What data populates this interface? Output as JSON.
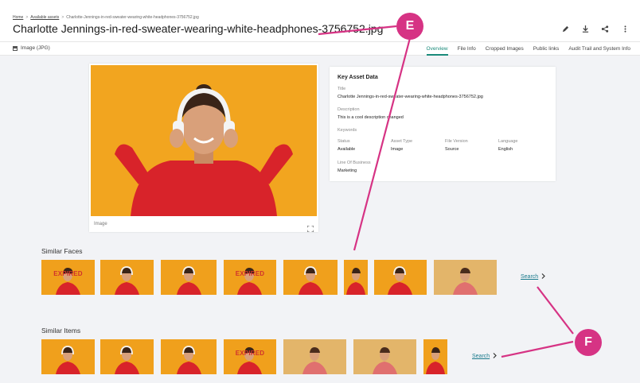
{
  "breadcrumb": {
    "home": "Home",
    "available": "Available assets",
    "current": "Charlotte-Jennings-in-red-sweater-wearing-white-headphones-3756752.jpg"
  },
  "page_title": "Charlotte Jennings-in-red-sweater-wearing-white-headphones-3756752.jpg",
  "asset_type": "Image (JPG)",
  "tabs": [
    {
      "label": "Overview",
      "active": true
    },
    {
      "label": "File Info"
    },
    {
      "label": "Cropped Images"
    },
    {
      "label": "Public links"
    },
    {
      "label": "Audit Trail and System Info"
    }
  ],
  "preview": {
    "label": "Image"
  },
  "key_asset": {
    "heading": "Key Asset Data",
    "title_label": "Title",
    "title_value": "Charlotte Jennings-in-red-sweater-wearing-white-headphones-3756752.jpg",
    "description_label": "Description",
    "description_value": "This is a cool description changed",
    "keywords_label": "Keywords",
    "status_label": "Status",
    "status_value": "Available",
    "asset_type_label": "Asset Type",
    "asset_type_value": "Image",
    "file_version_label": "File Version",
    "file_version_value": "Source",
    "language_label": "Language",
    "language_value": "English",
    "lob_label": "Line Of Business",
    "lob_value": "Marketing"
  },
  "similar_faces": {
    "heading": "Similar Faces",
    "expired_text": "EXPIRED",
    "search_label": "Search"
  },
  "similar_items": {
    "heading": "Similar Items",
    "expired_text": "EXPIRED",
    "search_label": "Search"
  },
  "annotations": {
    "e": "E",
    "f": "F"
  },
  "colors": {
    "accent": "#1a8a7a",
    "badge": "#d63384",
    "photo_bg": "#f2a51f",
    "sweater": "#d8232a",
    "expired": "#d0312d"
  }
}
